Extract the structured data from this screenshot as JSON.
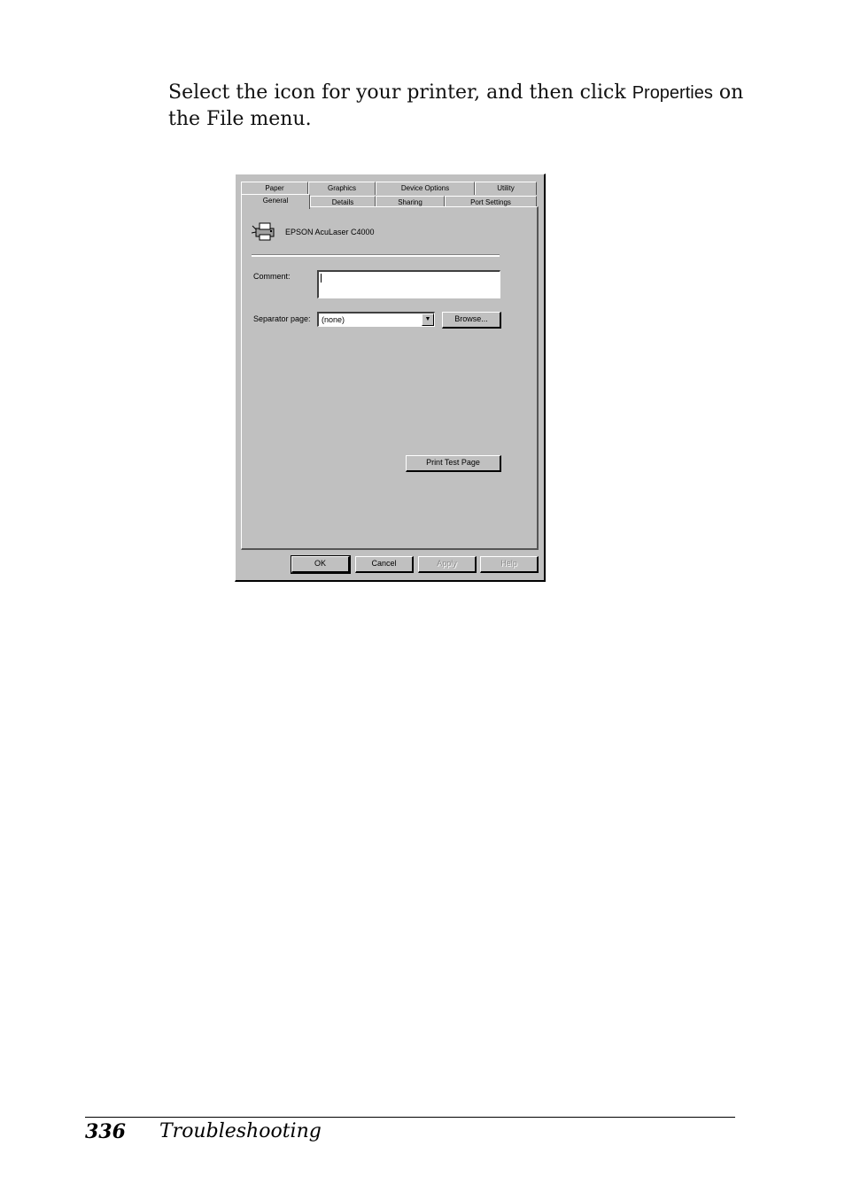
{
  "instruction": {
    "text_before": "Select the icon for your printer, and then click ",
    "ui_term": "Properties",
    "text_after": " on the File menu."
  },
  "dialog": {
    "tabs_back_row": [
      "Paper",
      "Graphics",
      "Device Options",
      "Utility"
    ],
    "tabs_front_row": [
      "General",
      "Details",
      "Sharing",
      "Port Settings"
    ],
    "active_tab": "General",
    "printer_name": "EPSON AcuLaser C4000",
    "comment_label": "Comment:",
    "comment_value": "",
    "separator_label": "Separator page:",
    "separator_value": "(none)",
    "browse_button": "Browse...",
    "print_test_button": "Print Test Page",
    "buttons": {
      "ok": "OK",
      "cancel": "Cancel",
      "apply": "Apply",
      "help": "Help"
    }
  },
  "footer": {
    "page_number": "336",
    "section_title": "Troubleshooting"
  }
}
